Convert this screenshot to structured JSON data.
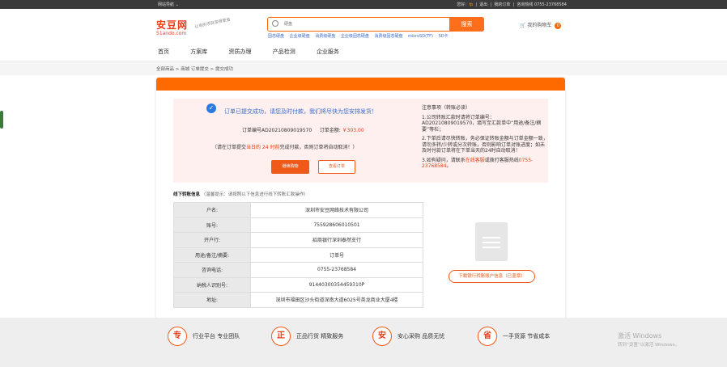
{
  "topbar": {
    "left": "网站导航 ⌄",
    "welcome": "您好：",
    "user": "fp",
    "logout": "退出",
    "my_orders": "我的订单",
    "hotline": "咨询热线 0755-23768584"
  },
  "logo": {
    "text_cn": "安豆网",
    "text_en": "51ando.com",
    "slogan": "让电的项目变得更省"
  },
  "search": {
    "placeholder": "硬盘",
    "button": "搜索"
  },
  "hotwords": [
    "固态硬盘",
    "企业级硬盘",
    "消费级硬盘",
    "企业级固态硬盘",
    "消费级固态硬盘",
    "microSD(TF)",
    "SD卡"
  ],
  "cart": {
    "label": "我的购物车",
    "count": "0"
  },
  "nav": [
    "首页",
    "方案库",
    "资质办理",
    "产品检测",
    "企业服务"
  ],
  "breadcrumb": "全部商品 > 商城 订单提交 > 提交成功",
  "success": {
    "message": "订单已提交成功，请您及时付款，我们将尽快为您安排发货！",
    "order_no": "订单编号AD20210809019570",
    "amount_label": "订单金额:",
    "amount": "￥303.00",
    "pay_note_pre": "（请在订单提交",
    "pay_note_red": "当日的 24 时前",
    "pay_note_post": "完成付款，否则订单将自动取消！）",
    "btn_continue": "继续购物",
    "btn_view": "查看订单"
  },
  "notes": {
    "title": "注意事项（转账必读）",
    "items": [
      "1.公司转账汇款时请将订单编号：AD20210809019570，填写至汇款单中“用途/备注/摘要”等栏；",
      "2.下单后请尽快转账，务必保证转账金额与订单金额一致，请勿多转/少转或分次转账，否则影响订单对账进度；如未及时付款订单将在下单当天的24时自动取消！",
      "3.如有疑问，请联系"
    ],
    "item3_link": "在线客服",
    "item3_mid": "或拨打客服热线",
    "item3_phone": "0755-23768584",
    "item3_end": "。"
  },
  "offline": {
    "title": "线下转账信息",
    "hint": "（温馨提示：请按照以下信息进行线下转账汇款操作）",
    "rows": [
      {
        "k": "户名:",
        "v": "深圳市安豆网络技术有限公司"
      },
      {
        "k": "账号:",
        "v": "755928606010501"
      },
      {
        "k": "开户行:",
        "v": "招商银行深圳泰然支行"
      },
      {
        "k": "用途/备注/摘要:",
        "v": "订单号"
      },
      {
        "k": "咨询电话:",
        "v": "0755-23768584"
      },
      {
        "k": "纳税人识别号:",
        "v": "91440300354459310P"
      },
      {
        "k": "地址:",
        "v": "深圳市福田区沙头街道深南大道6025号英龙商业大厦4楼"
      }
    ],
    "download": "下载银行转账账户信息（已盖章）"
  },
  "footer": [
    {
      "icon": "专",
      "text": "行业平台 专业团队"
    },
    {
      "icon": "正",
      "text": "正品行货 精致服务"
    },
    {
      "icon": "安",
      "text": "安心采购 品质无忧"
    },
    {
      "icon": "省",
      "text": "一手货源 节省成本"
    }
  ],
  "watermark": {
    "line1": "激活 Windows",
    "line2": "转到“设置”以激活 Windows。"
  }
}
